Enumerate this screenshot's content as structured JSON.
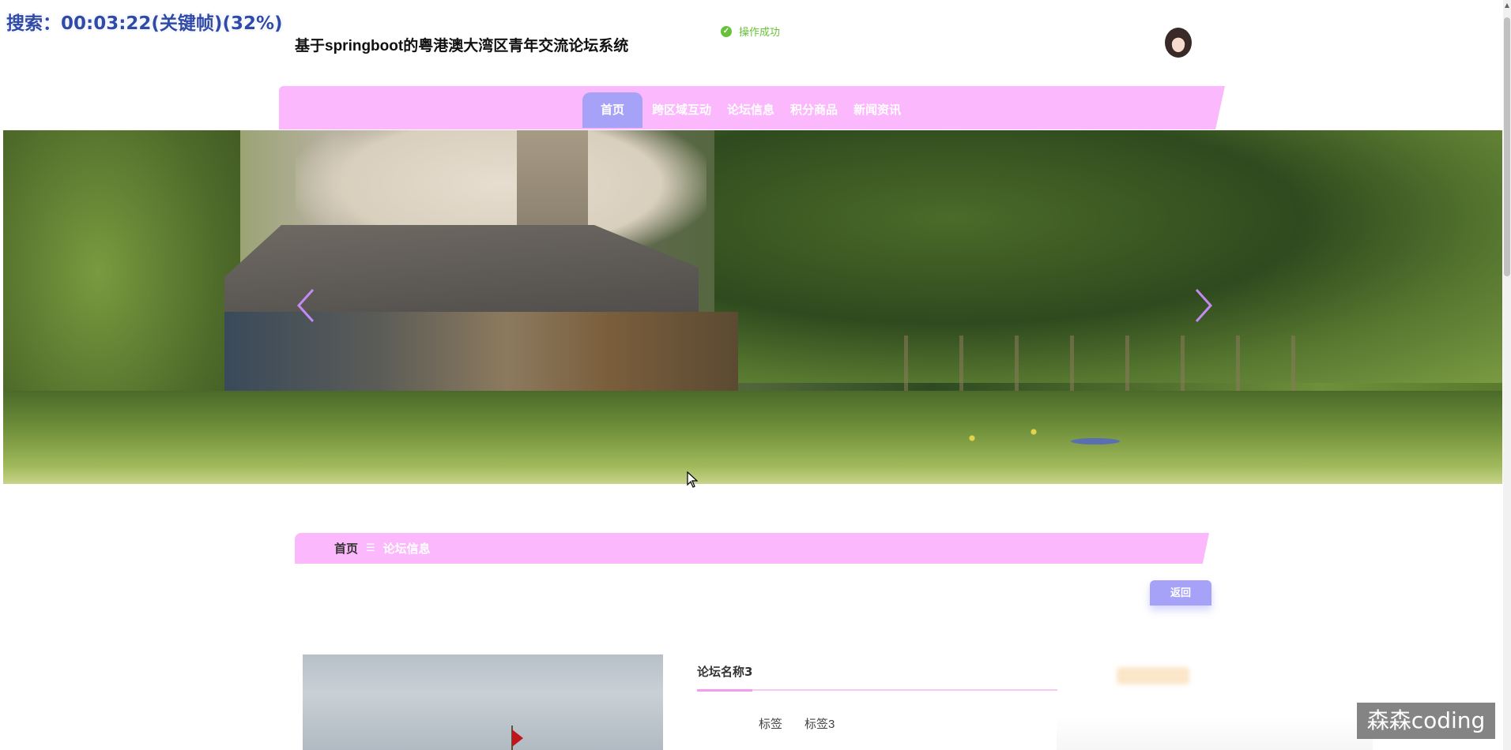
{
  "overlay": {
    "recording_label": "搜索：00:03:22(关键帧)(32%)"
  },
  "header": {
    "site_title": "基于springboot的粤港澳大湾区青年交流论坛系统",
    "toast": {
      "icon": "check-circle-icon",
      "text": "操作成功",
      "color": "#67c23a"
    }
  },
  "nav": {
    "items": [
      {
        "label": "首页",
        "active": true
      },
      {
        "label": "跨区域互动",
        "active": false
      },
      {
        "label": "论坛信息",
        "active": false
      },
      {
        "label": "积分商品",
        "active": false
      },
      {
        "label": "新闻资讯",
        "active": false
      }
    ],
    "bar_color": "#fbb8fc",
    "active_color": "#a5a2f8"
  },
  "carousel": {
    "prev_icon": "chevron-left-icon",
    "next_icon": "chevron-right-icon"
  },
  "breadcrumb": {
    "home": "首页",
    "separator": "☰",
    "current": "论坛信息"
  },
  "actions": {
    "back_label": "返回"
  },
  "detail": {
    "forum_name": "论坛名称3",
    "tag_label": "标签",
    "tag_value": "标签3"
  },
  "watermark": {
    "text": "森森coding"
  }
}
